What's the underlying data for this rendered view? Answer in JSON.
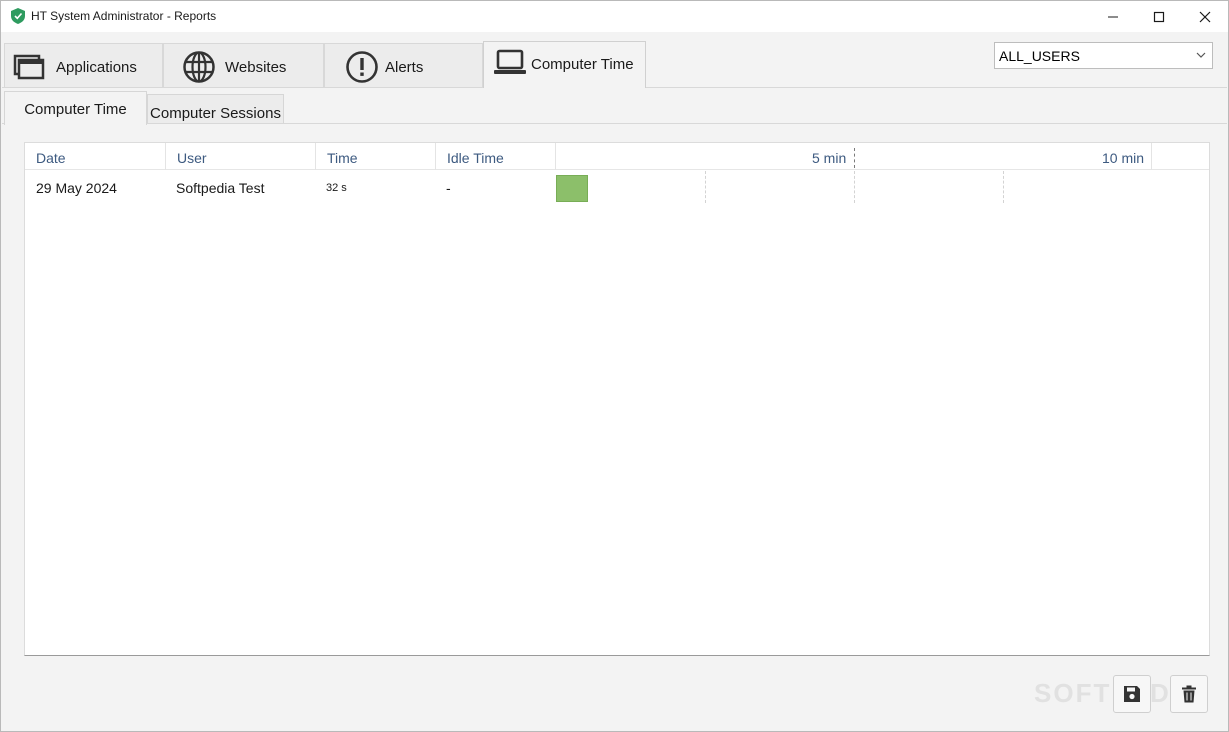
{
  "window": {
    "title": "HT System Administrator - Reports"
  },
  "main_tabs": [
    {
      "label": "Applications",
      "icon": "applications-icon"
    },
    {
      "label": "Websites",
      "icon": "globe-icon"
    },
    {
      "label": "Alerts",
      "icon": "alert-icon"
    },
    {
      "label": "Computer Time",
      "icon": "laptop-icon",
      "active": true
    }
  ],
  "user_filter": {
    "selected": "ALL_USERS"
  },
  "sub_tabs": [
    {
      "label": "Computer Time",
      "active": true
    },
    {
      "label": "Computer Sessions"
    }
  ],
  "grid": {
    "columns": [
      "Date",
      "User",
      "Time",
      "Idle Time"
    ],
    "timeline_labels": [
      "5 min",
      "10 min"
    ],
    "rows": [
      {
        "date": "29 May 2024",
        "user": "Softpedia Test",
        "time": "32 s",
        "idle_time": "-",
        "duration_seconds": 32
      }
    ]
  },
  "watermark": "SOFTPEDIA",
  "colors": {
    "bar": "#8cbf6a",
    "header_text": "#3d5a80",
    "shield": "#2e9b5f"
  }
}
